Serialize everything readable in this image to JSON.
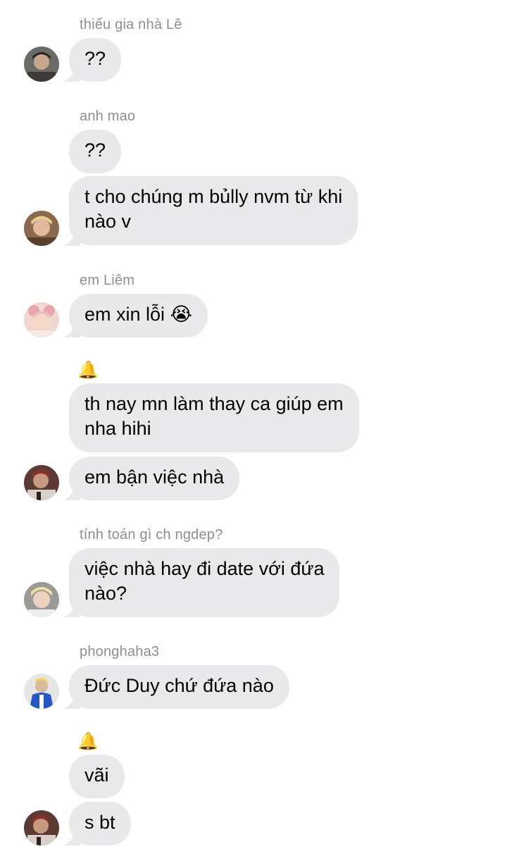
{
  "messages": [
    {
      "sender": "thiếu gia nhà Lê",
      "text": "??"
    },
    {
      "sender": "anh mao",
      "text": "??"
    },
    {
      "text": "t cho chúng m bủlly nvm từ khi\nnào v"
    },
    {
      "sender": "em Liêm",
      "text": "em xin lỗi 😭"
    },
    {
      "sender_icon": "bell-icon",
      "text": "th nay mn làm thay ca giúp em\nnha hihi"
    },
    {
      "text": "em bận việc nhà"
    },
    {
      "sender": "tính toán gì ch ngdep?",
      "text": "việc nhà hay đi date với đứa\nnào?"
    },
    {
      "sender": "phonghaha3",
      "text": "Đức Duy chứ đứa nào"
    },
    {
      "sender_icon": "bell-icon",
      "text": "vãi"
    },
    {
      "text": "s bt"
    }
  ],
  "colors": {
    "bubble": "#e9e9eb",
    "sender_name": "#8e8e93",
    "background": "#ffffff"
  }
}
